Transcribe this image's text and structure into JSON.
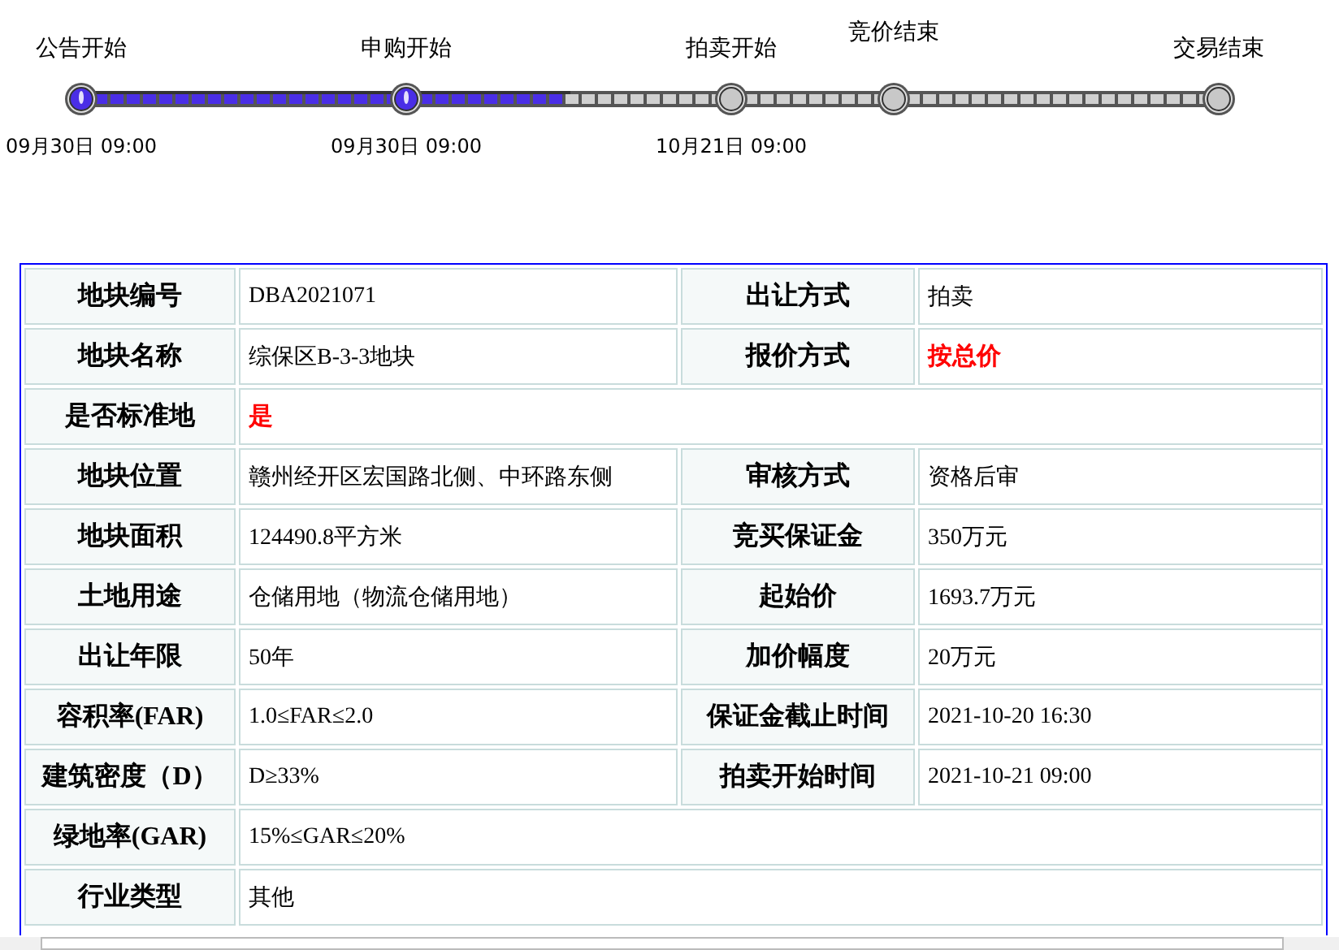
{
  "timeline": {
    "level": 0.43,
    "steps": [
      {
        "label": "公告开始",
        "date": "09月30日  09:00",
        "done": true
      },
      {
        "label": "申购开始",
        "date": "09月30日  09:00",
        "done": true
      },
      {
        "label": "拍卖开始",
        "date": "10月21日  09:00",
        "done": false
      },
      {
        "label": "竞价结束",
        "done": false
      },
      {
        "label": "交易结束",
        "done": false
      }
    ]
  },
  "table": {
    "rows": [
      [
        {
          "label": "地块编号",
          "value": "DBA2021071"
        },
        {
          "label": "出让方式",
          "value": "拍卖"
        }
      ],
      [
        {
          "label": "地块名称",
          "value": "综保区B-3-3地块"
        },
        {
          "label": "报价方式",
          "value": "按总价",
          "highlight": true
        }
      ],
      [
        {
          "label": "是否标准地",
          "value": "是",
          "highlight": true
        }
      ],
      [
        {
          "label": "地块位置",
          "value": "赣州经开区宏国路北侧、中环路东侧"
        },
        {
          "label": "审核方式",
          "value": "资格后审"
        }
      ],
      [
        {
          "label": "地块面积",
          "value": "124490.8平方米"
        },
        {
          "label": "竞买保证金",
          "value": "350万元"
        }
      ],
      [
        {
          "label": "土地用途",
          "value": "仓储用地（物流仓储用地）"
        },
        {
          "label": "起始价",
          "value": "1693.7万元"
        }
      ],
      [
        {
          "label": "出让年限",
          "value": "50年"
        },
        {
          "label": "加价幅度",
          "value": "20万元"
        }
      ],
      [
        {
          "label": "容积率(FAR)",
          "value": "1.0≤FAR≤2.0"
        },
        {
          "label": "保证金截止时间",
          "value": "2021-10-20 16:30"
        }
      ],
      [
        {
          "label": "建筑密度（D）",
          "value": "D≥33%"
        },
        {
          "label": "拍卖开始时间",
          "value": "2021-10-21 09:00"
        }
      ],
      [
        {
          "label": "绿地率(GAR)",
          "value": "15%≤GAR≤20%"
        }
      ],
      [
        {
          "label": "行业类型",
          "value": "其他"
        }
      ]
    ]
  }
}
